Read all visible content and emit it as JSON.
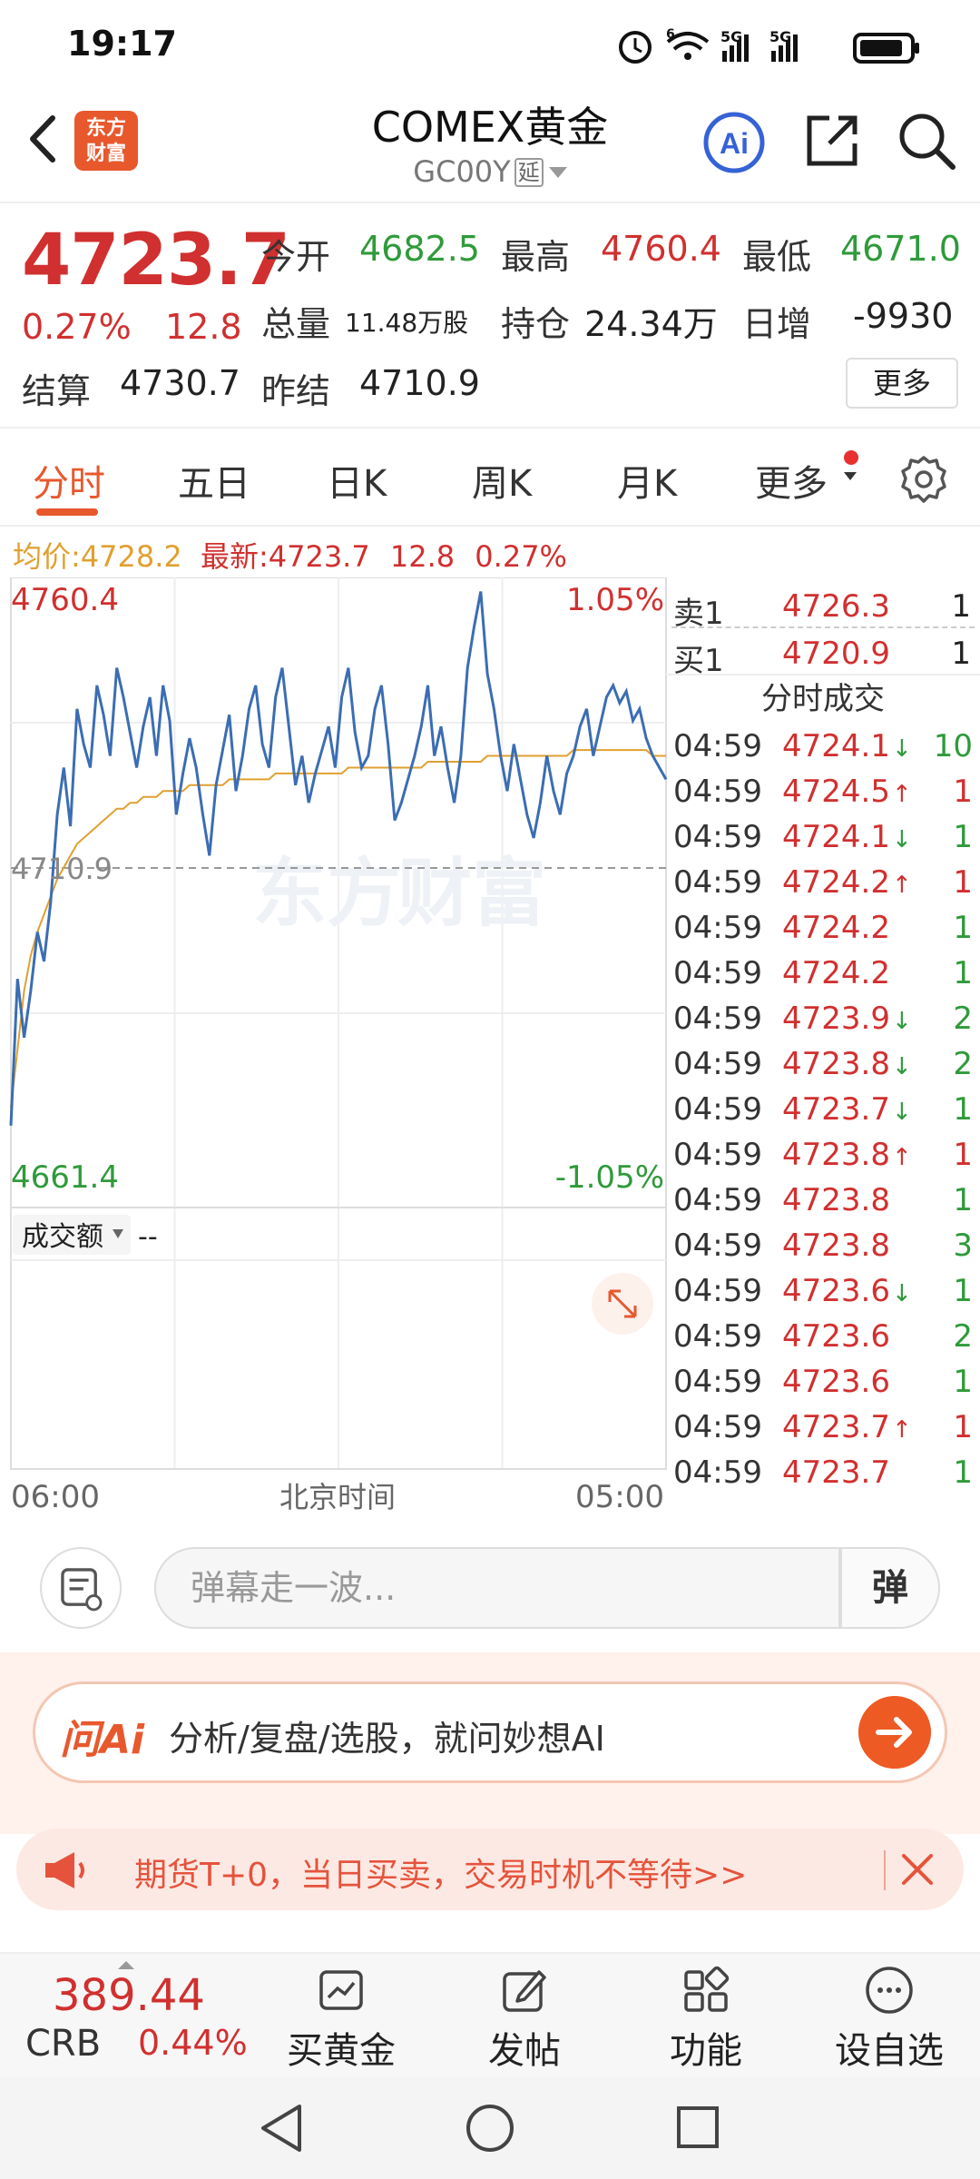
{
  "status_bar": {
    "time": "19:17",
    "net1": "5G",
    "net2": "5G",
    "wifi_badge": "6"
  },
  "header": {
    "logo_line1": "东方",
    "logo_line2": "财富",
    "title": "COMEX黄金",
    "subtitle": "GC00Y",
    "delay_tag": "延"
  },
  "quote": {
    "price": "4723.7",
    "change_pct": "0.27%",
    "change": "12.8",
    "open_label": "今开",
    "open": "4682.5",
    "high_label": "最高",
    "high": "4760.4",
    "low_label": "最低",
    "low": "4671.0",
    "volume_label": "总量",
    "volume": "11.48万股",
    "oi_label": "持仓",
    "oi": "24.34万",
    "daily_inc_label": "日增",
    "daily_inc": "-9930",
    "settle_label": "结算",
    "settle": "4730.7",
    "prev_settle_label": "昨结",
    "prev_settle": "4710.9",
    "more": "更多"
  },
  "tabs": [
    "分时",
    "五日",
    "日K",
    "周K",
    "月K",
    "更多"
  ],
  "avg_line": {
    "avg_label": "均价:",
    "avg": "4728.2",
    "latest_label": "最新:",
    "latest": "4723.7",
    "change": "12.8",
    "pct": "0.27%"
  },
  "chart_data": {
    "type": "line",
    "y_max_label": "4760.4",
    "y_min_label": "4661.4",
    "ref_label": "4710.9",
    "pct_top": "1.05%",
    "pct_bottom": "-1.05%",
    "ylim": [
      4661.4,
      4760.4
    ],
    "reference": 4710.9,
    "x_start": "06:00",
    "x_mid": "北京时间",
    "x_end": "05:00",
    "volume_label": "成交额",
    "volume_value": "--",
    "colors": {
      "price": "#3b6db3",
      "average": "#e0a030"
    },
    "series": [
      {
        "values": [
          4667,
          4692,
          4682,
          4690,
          4700,
          4695,
          4705,
          4720,
          4728,
          4718,
          4738,
          4732,
          4728,
          4742,
          4737,
          4730,
          4745,
          4740,
          4734,
          4728,
          4735,
          4740,
          4730,
          4742,
          4736,
          4720,
          4727,
          4733,
          4728,
          4720,
          4713,
          4725,
          4731,
          4737,
          4724,
          4730,
          4738,
          4742,
          4732,
          4728,
          4740,
          4745,
          4735,
          4725,
          4730,
          4722,
          4727,
          4731,
          4735,
          4728,
          4740,
          4745,
          4734,
          4728,
          4730,
          4738,
          4742,
          4732,
          4719,
          4722,
          4726,
          4730,
          4735,
          4742,
          4730,
          4735,
          4728,
          4722,
          4730,
          4745,
          4752,
          4758,
          4744,
          4738,
          4730,
          4724,
          4732,
          4726,
          4720,
          4716,
          4722,
          4730,
          4724,
          4720,
          4727,
          4730,
          4735,
          4738,
          4730,
          4735,
          4740,
          4742,
          4739,
          4741,
          4736,
          4738,
          4733,
          4730,
          4728,
          4726
        ]
      },
      {
        "values": [
          4670,
          4680,
          4690,
          4696,
          4700,
          4703,
          4706,
          4709,
          4711,
          4713,
          4715,
          4716,
          4717,
          4718,
          4719,
          4720,
          4721,
          4721,
          4722,
          4722,
          4723,
          4723,
          4723,
          4724,
          4724,
          4724,
          4724,
          4725,
          4725,
          4725,
          4725,
          4725,
          4725,
          4726,
          4726,
          4726,
          4726,
          4726,
          4726,
          4726,
          4727,
          4727,
          4727,
          4727,
          4727,
          4727,
          4727,
          4727,
          4727,
          4727,
          4727,
          4728,
          4728,
          4728,
          4728,
          4728,
          4728,
          4728,
          4728,
          4728,
          4728,
          4728,
          4728,
          4729,
          4729,
          4729,
          4729,
          4729,
          4729,
          4729,
          4729,
          4729,
          4730,
          4730,
          4730,
          4730,
          4730,
          4730,
          4730,
          4730,
          4730,
          4730,
          4730,
          4730,
          4730,
          4731,
          4731,
          4731,
          4731,
          4731,
          4731,
          4731,
          4731,
          4731,
          4731,
          4731,
          4731,
          4730,
          4730,
          4730
        ]
      }
    ]
  },
  "order_book": {
    "ask_label": "卖1",
    "ask_price": "4726.3",
    "ask_qty": "1",
    "bid_label": "买1",
    "bid_price": "4720.9",
    "bid_qty": "1",
    "ticks_title": "分时成交",
    "ticks": [
      {
        "time": "04:59",
        "price": "4724.1",
        "dir": "down",
        "qty": "10"
      },
      {
        "time": "04:59",
        "price": "4724.5",
        "dir": "up",
        "qty": "1"
      },
      {
        "time": "04:59",
        "price": "4724.1",
        "dir": "down",
        "qty": "1"
      },
      {
        "time": "04:59",
        "price": "4724.2",
        "dir": "up",
        "qty": "1"
      },
      {
        "time": "04:59",
        "price": "4724.2",
        "dir": "",
        "qty": "1"
      },
      {
        "time": "04:59",
        "price": "4724.2",
        "dir": "",
        "qty": "1"
      },
      {
        "time": "04:59",
        "price": "4723.9",
        "dir": "down",
        "qty": "2"
      },
      {
        "time": "04:59",
        "price": "4723.8",
        "dir": "down",
        "qty": "2"
      },
      {
        "time": "04:59",
        "price": "4723.7",
        "dir": "down",
        "qty": "1"
      },
      {
        "time": "04:59",
        "price": "4723.8",
        "dir": "up",
        "qty": "1"
      },
      {
        "time": "04:59",
        "price": "4723.8",
        "dir": "",
        "qty": "1"
      },
      {
        "time": "04:59",
        "price": "4723.8",
        "dir": "",
        "qty": "3"
      },
      {
        "time": "04:59",
        "price": "4723.6",
        "dir": "down",
        "qty": "1"
      },
      {
        "time": "04:59",
        "price": "4723.6",
        "dir": "",
        "qty": "2"
      },
      {
        "time": "04:59",
        "price": "4723.6",
        "dir": "",
        "qty": "1"
      },
      {
        "time": "04:59",
        "price": "4723.7",
        "dir": "up",
        "qty": "1"
      },
      {
        "time": "04:59",
        "price": "4723.7",
        "dir": "",
        "qty": "1"
      }
    ]
  },
  "comment": {
    "placeholder": "弹幕走一波...",
    "button": "弹"
  },
  "ai_banner": {
    "brand": "问Ai",
    "text": "分析/复盘/选股，就问妙想AI"
  },
  "promo": {
    "text": "期货T+0，当日买卖，交易时机不等待>>"
  },
  "bottom_nav": {
    "crb_value": "389.44",
    "crb_name": "CRB",
    "crb_pct": "0.44%",
    "items": [
      "买黄金",
      "发帖",
      "功能",
      "设自选"
    ]
  }
}
